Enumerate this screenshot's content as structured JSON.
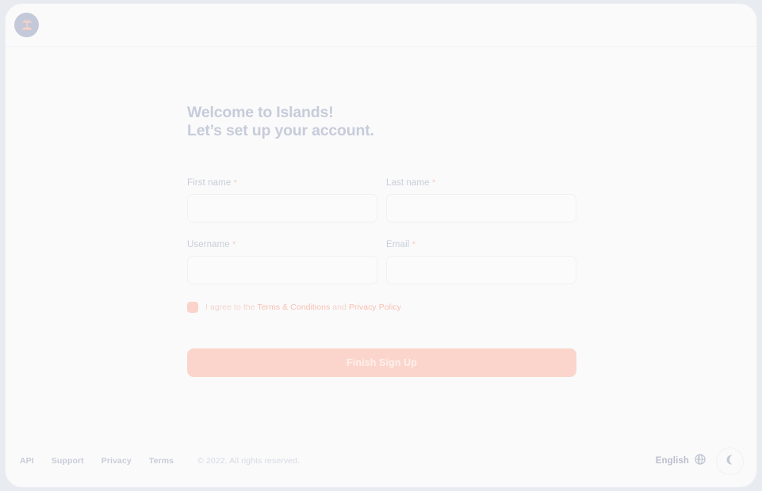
{
  "app": {
    "logo_icon": "palm-tree-island-logo-icon"
  },
  "main": {
    "title_line1": "Welcome to Islands!",
    "title_line2": "Let’s set up your account.",
    "form": {
      "fields": [
        {
          "label": "First name",
          "required_mark": "*",
          "value": "",
          "placeholder": "",
          "name": "first-name"
        },
        {
          "label": "Last name",
          "required_mark": "*",
          "value": "",
          "placeholder": "",
          "name": "last-name"
        },
        {
          "label": "Username",
          "required_mark": "*",
          "value": "",
          "placeholder": "",
          "name": "username"
        },
        {
          "label": "Email",
          "required_mark": "*",
          "value": "",
          "placeholder": "",
          "name": "email"
        }
      ],
      "terms": {
        "checked": true,
        "prefix": "I agree to the ",
        "terms_link": "Terms & Conditions",
        "conjunction": " and ",
        "privacy_link": "Privacy Policy"
      },
      "submit_label": "Finish Sign Up"
    }
  },
  "footer": {
    "links": [
      {
        "label": "API"
      },
      {
        "label": "Support"
      },
      {
        "label": "Privacy"
      },
      {
        "label": "Terms"
      }
    ],
    "copyright": "© 2022. All rights reserved.",
    "language_label": "English",
    "language_icon": "globe-icon",
    "theme_toggle_icon": "moon-icon"
  },
  "colors": {
    "accent": "#fbd5cb",
    "accent_link": "#f8c0b2",
    "text_muted": "#c6ccd9",
    "page_background": "#e8ebf0",
    "card_background": "#fafafb"
  }
}
